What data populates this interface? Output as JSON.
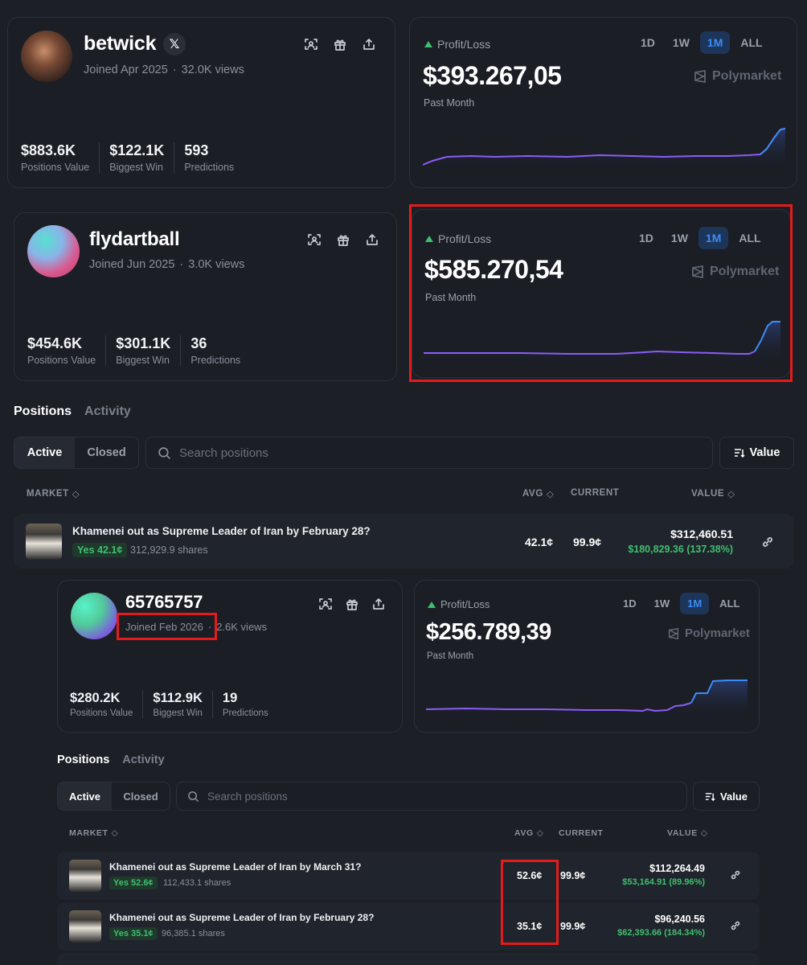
{
  "profiles": [
    {
      "username": "betwick",
      "joined": "Joined Apr 2025",
      "views": "32.0K views",
      "stats": [
        {
          "value": "$883.6K",
          "label": "Positions Value"
        },
        {
          "value": "$122.1K",
          "label": "Biggest Win"
        },
        {
          "value": "593",
          "label": "Predictions"
        }
      ],
      "pl": {
        "label": "Profit/Loss",
        "value": "$393.267,05",
        "period": "Past Month",
        "ranges": [
          "1D",
          "1W",
          "1M",
          "ALL"
        ],
        "active_range": "1M",
        "brand": "Polymarket"
      }
    },
    {
      "username": "flydartball",
      "joined": "Joined Jun 2025",
      "views": "3.0K views",
      "stats": [
        {
          "value": "$454.6K",
          "label": "Positions Value"
        },
        {
          "value": "$301.1K",
          "label": "Biggest Win"
        },
        {
          "value": "36",
          "label": "Predictions"
        }
      ],
      "pl": {
        "label": "Profit/Loss",
        "value": "$585.270,54",
        "period": "Past Month",
        "ranges": [
          "1D",
          "1W",
          "1M",
          "ALL"
        ],
        "active_range": "1M",
        "brand": "Polymarket"
      }
    },
    {
      "username": "65765757",
      "joined": "Joined Feb 2026",
      "views": "2.6K views",
      "stats": [
        {
          "value": "$280.2K",
          "label": "Positions Value"
        },
        {
          "value": "$112.9K",
          "label": "Biggest Win"
        },
        {
          "value": "19",
          "label": "Predictions"
        }
      ],
      "pl": {
        "label": "Profit/Loss",
        "value": "$256.789,39",
        "period": "Past Month",
        "ranges": [
          "1D",
          "1W",
          "1M",
          "ALL"
        ],
        "active_range": "1M",
        "brand": "Polymarket"
      }
    }
  ],
  "x_badge": "𝕏",
  "tabs": {
    "positions": "Positions",
    "activity": "Activity"
  },
  "filter": {
    "active": "Active",
    "closed": "Closed",
    "search_placeholder": "Search positions",
    "sort": "Value"
  },
  "columns": {
    "market": "MARKET",
    "avg": "AVG",
    "current": "CURRENT",
    "value": "VALUE"
  },
  "positions_a": [
    {
      "title": "Khamenei out as Supreme Leader of Iran by February 28?",
      "badge": "Yes 42.1¢",
      "shares": "312,929.9 shares",
      "avg": "42.1¢",
      "current": "99.9¢",
      "value": "$312,460.51",
      "pnl": "$180,829.36 (137.38%)"
    }
  ],
  "positions_b": [
    {
      "title": "Khamenei out as Supreme Leader of Iran by March 31?",
      "badge": "Yes 52.6¢",
      "shares": "112,433.1 shares",
      "avg": "52.6¢",
      "current": "99.9¢",
      "value": "$112,264.49",
      "pnl": "$53,164.91 (89.96%)"
    },
    {
      "title": "Khamenei out as Supreme Leader of Iran by February 28?",
      "badge": "Yes 35.1¢",
      "shares": "96,385.1 shares",
      "avg": "35.1¢",
      "current": "99.9¢",
      "value": "$96,240.56",
      "pnl": "$62,393.66 (184.34%)"
    }
  ],
  "colors": {
    "accent_blue": "#3b8cf6",
    "profit_green": "#3fbf6f",
    "line_purple": "#8b5cf6",
    "highlight_red": "#e51b1b"
  }
}
